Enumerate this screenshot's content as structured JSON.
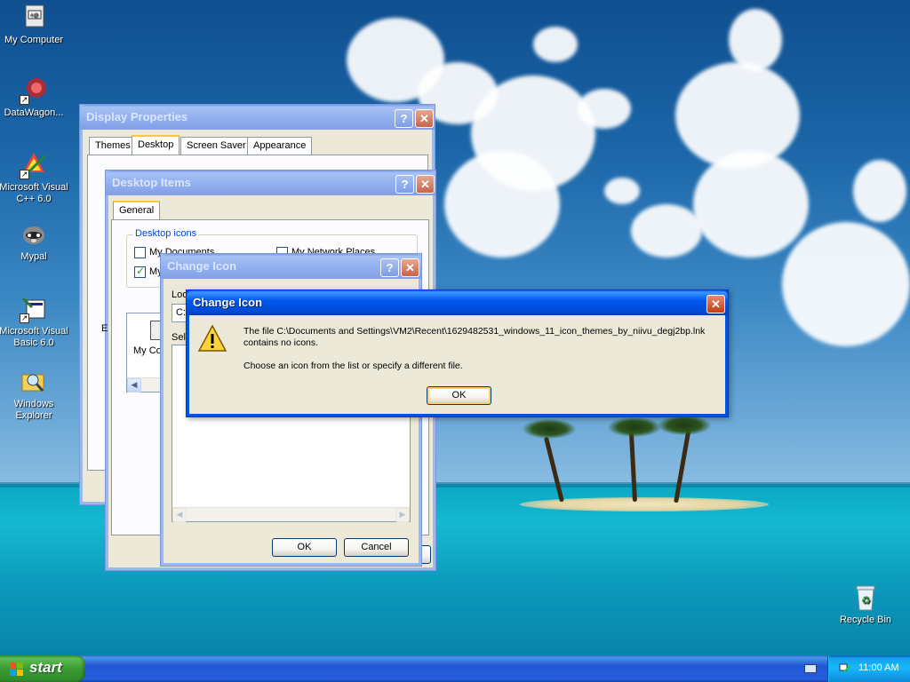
{
  "desktop": {
    "icons": [
      {
        "label": "My Computer",
        "icon": "my-computer-icon"
      },
      {
        "label": "DataWagon...",
        "icon": "datawagon-icon"
      },
      {
        "label": "Microsoft Visual C++ 6.0",
        "icon": "visual-cpp-icon"
      },
      {
        "label": "Mypal",
        "icon": "mypal-raccoon-icon"
      },
      {
        "label": "Microsoft Visual Basic 6.0",
        "icon": "visual-basic-icon"
      },
      {
        "label": "Windows Explorer",
        "icon": "windows-explorer-icon"
      },
      {
        "label": "Recycle Bin",
        "icon": "recycle-bin-icon"
      }
    ]
  },
  "display_properties": {
    "title": "Display Properties",
    "tabs": [
      "Themes",
      "Desktop",
      "Screen Saver",
      "Appearance"
    ],
    "selected_tab": "Desktop",
    "help": "?",
    "close": "✕"
  },
  "desktop_items": {
    "title": "Desktop Items",
    "tab": "General",
    "group_label": "Desktop icons",
    "checkboxes": [
      {
        "label": "My Documents",
        "checked": false
      },
      {
        "label": "My Network Places",
        "checked": false
      },
      {
        "label": "My",
        "checked": true
      }
    ],
    "partial_left_text": "E",
    "icon_caption": "My Co",
    "help": "?",
    "close": "✕"
  },
  "change_icon_dialog": {
    "title": "Change Icon",
    "look_label": "Loo",
    "path_value": "C:",
    "select_label": "Sele",
    "ok": "OK",
    "cancel": "Cancel",
    "help": "?",
    "close": "✕"
  },
  "error_dialog": {
    "title": "Change Icon",
    "message_line1": "The file C:\\Documents and Settings\\VM2\\Recent\\1629482531_windows_11_icon_themes_by_niivu_degj2bp.lnk",
    "message_line2": "contains no icons.",
    "message_line3": "Choose an icon from the list or specify a different file.",
    "ok": "OK",
    "close": "✕",
    "icon": "warning-icon"
  },
  "taskbar": {
    "start_label": "start",
    "clock": "11:00 AM"
  }
}
